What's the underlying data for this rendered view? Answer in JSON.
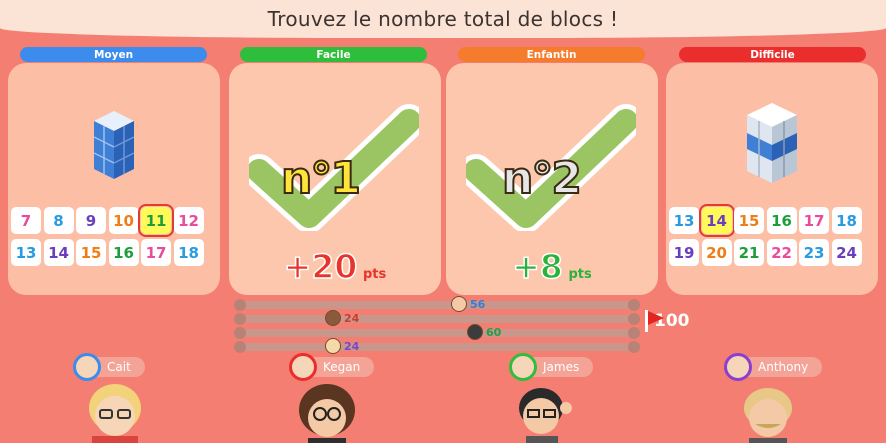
{
  "header": {
    "title": "Trouvez le nombre total de blocs !"
  },
  "cards": [
    {
      "difficulty": "Moyen",
      "color": "#3b8cec",
      "type": "question",
      "numbers": [
        "7",
        "8",
        "9",
        "10",
        "11",
        "12",
        "13",
        "14",
        "15",
        "16",
        "17",
        "18"
      ],
      "selected": "11"
    },
    {
      "difficulty": "Facile",
      "color": "#2fbe3c",
      "type": "answer",
      "rank": "n°1",
      "points": "+20",
      "pts_label": "pts"
    },
    {
      "difficulty": "Enfantin",
      "color": "#f57c2c",
      "type": "answer",
      "rank": "n°2",
      "points": "+8",
      "pts_label": "pts"
    },
    {
      "difficulty": "Difficile",
      "color": "#ea2e2e",
      "type": "question",
      "numbers": [
        "13",
        "14",
        "15",
        "16",
        "17",
        "18",
        "19",
        "20",
        "21",
        "22",
        "23",
        "24"
      ],
      "selected": "14"
    }
  ],
  "number_colors": [
    "#e84c9a",
    "#2a9be0",
    "#6a3fbf",
    "#ef7e16",
    "#1e9e3b",
    "#e84c9a"
  ],
  "progress": {
    "goal": "100",
    "markers": [
      {
        "score": "56",
        "color": "#3a7bd5"
      },
      {
        "score": "24",
        "color": "#d23a2b"
      },
      {
        "score": "60",
        "color": "#1f9e4a"
      },
      {
        "score": "24",
        "color": "#7a45c9"
      }
    ]
  },
  "players": [
    {
      "name": "Cait",
      "ring": "#3b8cec"
    },
    {
      "name": "Kegan",
      "ring": "#ea2e2e"
    },
    {
      "name": "James",
      "ring": "#2fbe3c"
    },
    {
      "name": "Anthony",
      "ring": "#8a3fd0"
    }
  ]
}
